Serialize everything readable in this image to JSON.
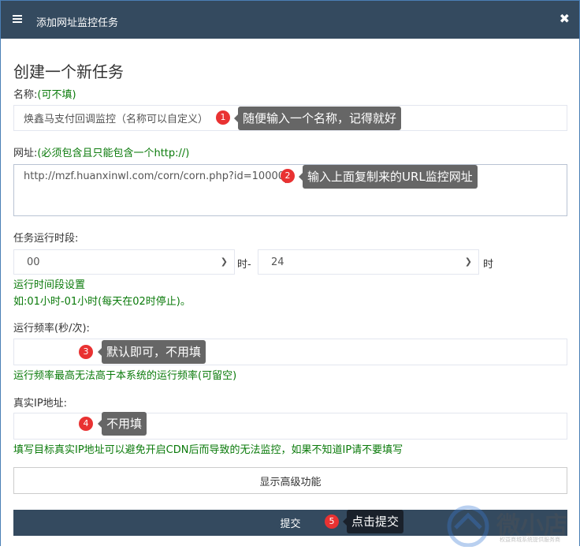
{
  "dialog": {
    "title": "添加网址监控任务",
    "close": "✖"
  },
  "form": {
    "heading": "创建一个新任务",
    "name_label": "名称:",
    "name_hint": "(可不填)",
    "name_value": "焕鑫马支付回调监控（名称可以自定义）",
    "url_label": "网址:",
    "url_hint": "(必须包含且只能包含一个http://)",
    "url_value": "http://mzf.huanxinwl.com/corn/corn.php?id=10000",
    "period_label": "任务运行时段:",
    "start_hour": "00",
    "sep": "时-",
    "end_hour": "24",
    "end_suffix": "时",
    "period_help1": "运行时间段设置",
    "period_help2": "如:01小时-01小时(每天在02时停止)。",
    "freq_label": "运行频率(秒/次):",
    "freq_help": "运行频率最高无法高于本系统的运行频率(可留空)",
    "ip_label": "真实IP地址:",
    "ip_help": "填写目标真实IP地址可以避免开启CDN后而导致的无法监控，如果不知道IP请不要填写",
    "advanced_button": "显示高级功能",
    "submit_button": "提交"
  },
  "annotations": [
    {
      "num": "1",
      "text": "随便输入一个名称，记得就好"
    },
    {
      "num": "2",
      "text": "输入上面复制来的URL监控网址"
    },
    {
      "num": "3",
      "text": "默认即可，不用填"
    },
    {
      "num": "4",
      "text": "不用填"
    },
    {
      "num": "5",
      "text": "点击提交"
    }
  ],
  "watermark": {
    "brand": "微小店",
    "tagline": "权益商城系统提供服务商"
  }
}
